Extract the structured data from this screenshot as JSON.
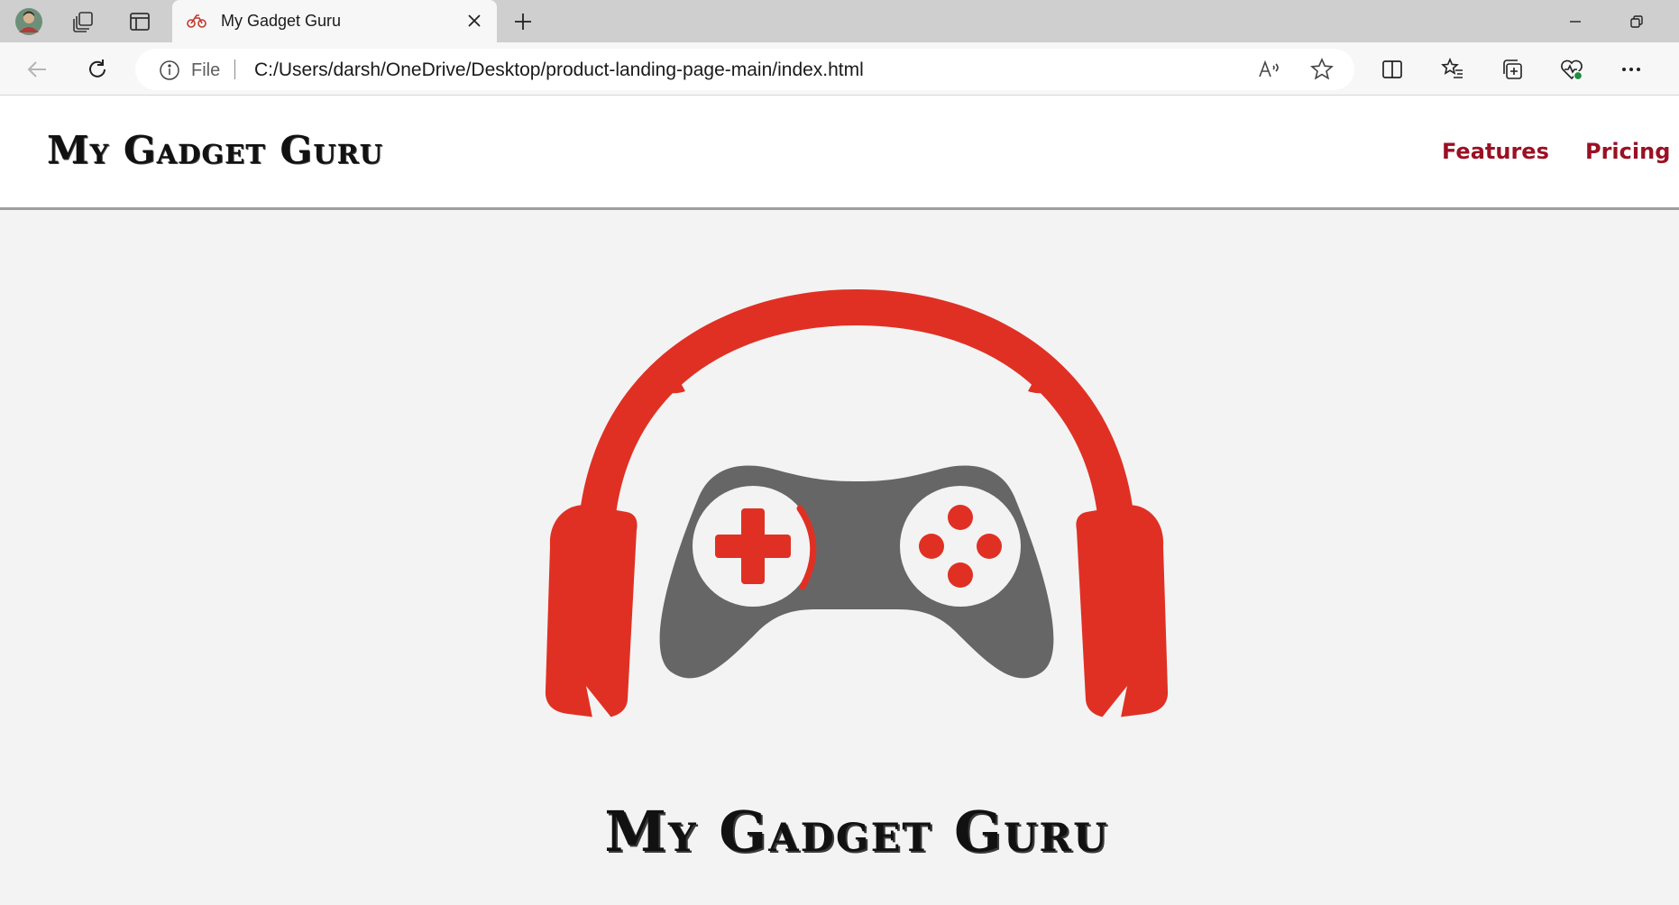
{
  "browser": {
    "tab": {
      "title": "My Gadget Guru"
    },
    "address_bar": {
      "scheme_label": "File",
      "url": "C:/Users/darsh/OneDrive/Desktop/product-landing-page-main/index.html"
    },
    "icons": {
      "profile": "profile-avatar-icon",
      "workspaces": "workspaces-icon",
      "tab_actions": "tab-actions-icon",
      "favicon": "motorbike-favicon-icon",
      "close_tab": "close-icon",
      "new_tab": "plus-icon",
      "minimize": "minimize-icon",
      "restore": "restore-icon",
      "back": "back-arrow-icon",
      "refresh": "refresh-icon",
      "info": "info-icon",
      "read_aloud": "read-aloud-icon",
      "favorite": "star-icon",
      "split_screen": "split-screen-icon",
      "favorites": "favorites-list-icon",
      "collections": "collections-icon",
      "health": "browser-essentials-icon",
      "more": "more-icon"
    }
  },
  "page": {
    "header": {
      "brand": "My Gadget Guru",
      "nav": [
        {
          "label": "Features"
        },
        {
          "label": "Pricing"
        }
      ]
    },
    "hero": {
      "brand": "My Gadget Guru"
    }
  },
  "colors": {
    "nav_link": "#9b1023",
    "logo_red": "#e03024",
    "logo_gray": "#666666"
  }
}
